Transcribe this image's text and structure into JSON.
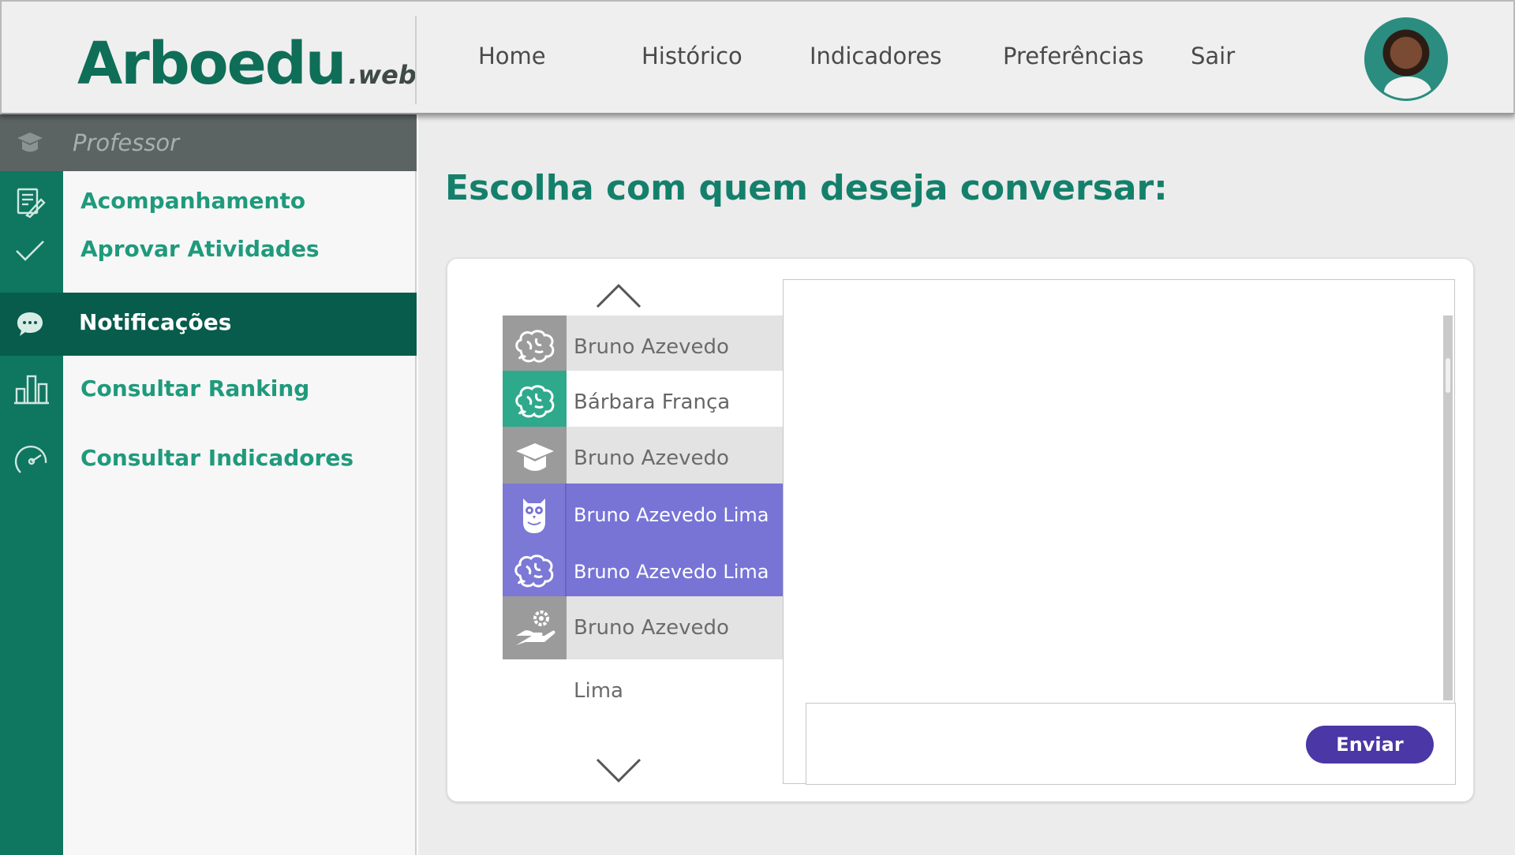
{
  "header": {
    "logo_main": "Arboedu",
    "logo_sub": ".web",
    "nav": [
      "Home",
      "Histórico",
      "Indicadores",
      "Preferências",
      "Sair"
    ]
  },
  "sidebar": {
    "role": "Professor",
    "items": [
      {
        "label": "Acompanhamento",
        "icon": "pencil-document-icon"
      },
      {
        "label": "Aprovar Atividades",
        "icon": "checkmark-icon"
      },
      {
        "label": "Notificações",
        "icon": "chat-bubble-icon"
      },
      {
        "label": "Consultar Ranking",
        "icon": "bar-chart-icon"
      },
      {
        "label": "Consultar Indicadores",
        "icon": "gauge-icon"
      }
    ],
    "active_index": 2
  },
  "main": {
    "title": "Escolha com quem deseja conversar:",
    "contacts": [
      {
        "name": "Bruno Azevedo Lima",
        "icon": "brain-icon",
        "style": "gray"
      },
      {
        "name": "Bárbara França",
        "icon": "brain-icon",
        "style": "selected"
      },
      {
        "name": "Bruno Azevedo Lima",
        "icon": "graduation-cap-icon",
        "style": "gray"
      },
      {
        "name": "Bruno Azevedo Lima",
        "icon": "owl-icon",
        "style": "purple"
      },
      {
        "name": "Bruno Azevedo Lima",
        "icon": "brain-icon",
        "style": "purple"
      },
      {
        "name": "Bruno Azevedo Lima",
        "icon": "hand-gear-icon",
        "style": "gray"
      }
    ],
    "send_label": "Enviar",
    "message_value": ""
  },
  "colors": {
    "brand_green": "#0f7660",
    "active_green": "#075c4c",
    "text_green": "#1f9a7c",
    "purple": "#7774d6",
    "send_button": "#4b37a5"
  }
}
